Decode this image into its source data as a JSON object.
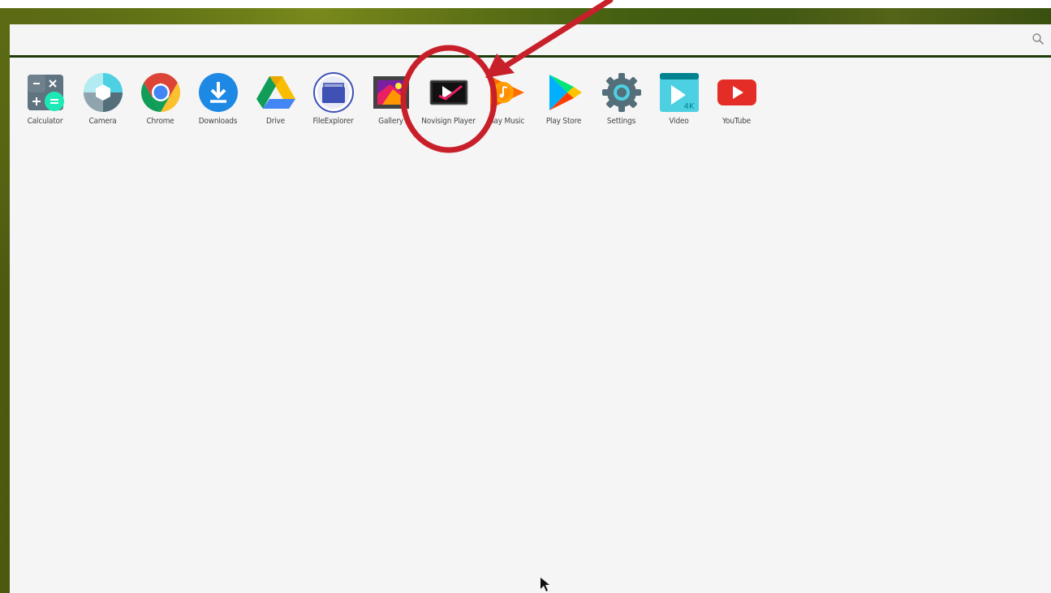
{
  "apps": [
    {
      "label": "Calculator",
      "icon": "calculator-icon"
    },
    {
      "label": "Camera",
      "icon": "camera-icon"
    },
    {
      "label": "Chrome",
      "icon": "chrome-icon"
    },
    {
      "label": "Downloads",
      "icon": "downloads-icon"
    },
    {
      "label": "Drive",
      "icon": "drive-icon"
    },
    {
      "label": "FileExplorer",
      "icon": "file-explorer-icon"
    },
    {
      "label": "Gallery",
      "icon": "gallery-icon"
    },
    {
      "label": "Novisign Player",
      "icon": "novisign-player-icon"
    },
    {
      "label": "Play Music",
      "icon": "play-music-icon"
    },
    {
      "label": "Play Store",
      "icon": "play-store-icon"
    },
    {
      "label": "Settings",
      "icon": "settings-icon"
    },
    {
      "label": "Video",
      "icon": "video-icon"
    },
    {
      "label": "YouTube",
      "icon": "youtube-icon"
    }
  ],
  "video_badge": "4K",
  "colors": {
    "annotation": "#c8202a",
    "drawer_bg": "#f5f5f5"
  }
}
